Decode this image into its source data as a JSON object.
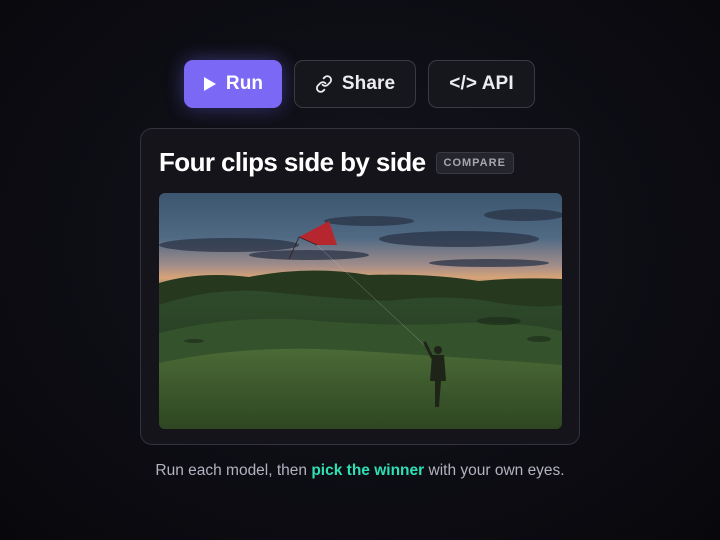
{
  "toolbar": {
    "run_label": "Run",
    "run_icon": "play-icon",
    "share_label": "Share",
    "share_icon": "link-icon",
    "api_label": "</> API"
  },
  "card": {
    "title": "Four clips side by side",
    "badge": "COMPARE",
    "media_description_icon": "video-frame"
  },
  "caption": {
    "before": "Run each model, then ",
    "highlight": "pick the winner",
    "after": " with your own eyes."
  },
  "colors": {
    "accent": "#7b68f5",
    "highlight": "#2fe0b4",
    "background": "#0d0d14",
    "card": "#14141a"
  }
}
